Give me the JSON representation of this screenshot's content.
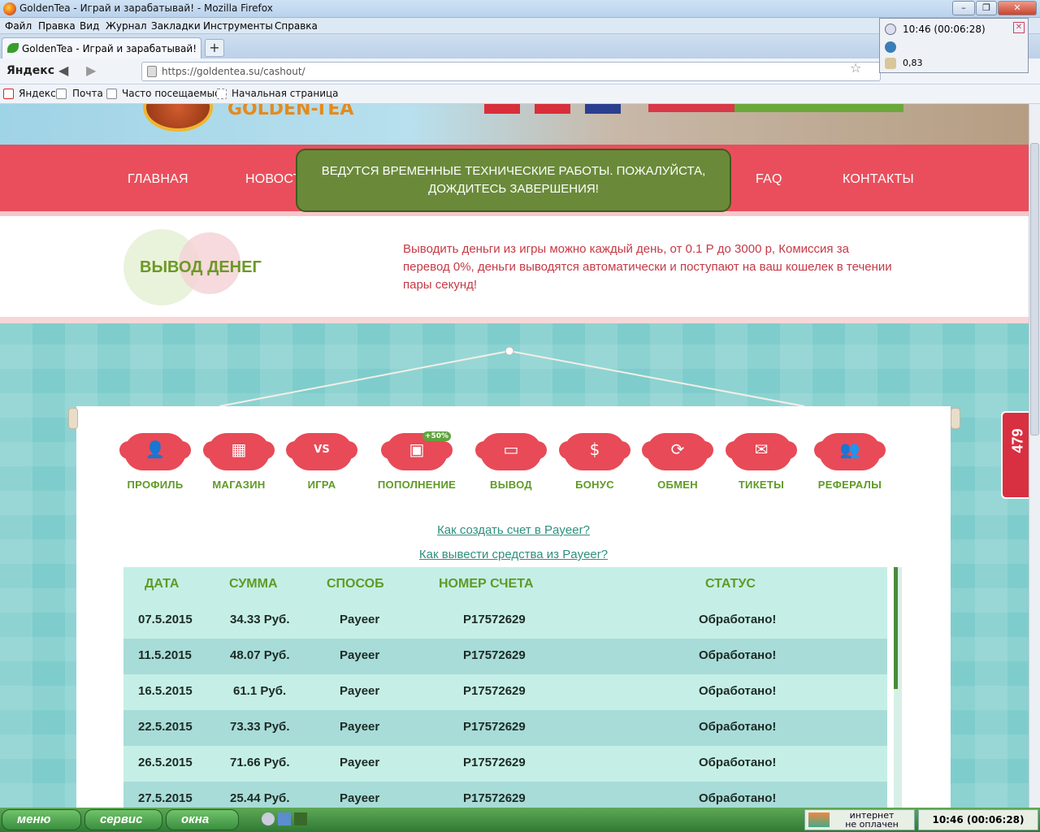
{
  "window": {
    "title": "GoldenTea - Играй и зарабатывай! - Mozilla Firefox"
  },
  "menubar": [
    "Файл",
    "Правка",
    "Вид",
    "Журнал",
    "Закладки",
    "Инструменты",
    "Справка"
  ],
  "tab": {
    "label": "GoldenTea - Играй и зарабатывай!",
    "new_tab": "+"
  },
  "nav": {
    "yandex": "Яндекс",
    "url": "https://goldentea.su/cashout/"
  },
  "bookmarks": [
    "Яндекс",
    "Почта",
    "Часто посещаемые",
    "Начальная страница"
  ],
  "clock_popup": {
    "time": "10:46 (00:06:28)",
    "value": "0,83"
  },
  "site": {
    "logo_text": "GOLDEN-TEA",
    "nav_items": [
      "ГЛАВНАЯ",
      "НОВОСТИ",
      "FAQ",
      "КОНТАКТЫ"
    ],
    "maintenance": "ВЕДУТСЯ ВРЕМЕННЫЕ ТЕХНИЧЕСКИЕ РАБОТЫ. ПОЖАЛУЙСТА, ДОЖДИТЕСЬ ЗАВЕРШЕНИЯ!",
    "section_title": "ВЫВОД ДЕНЕГ",
    "section_desc": "Выводить деньги из игры можно каждый день, от 0.1 Р до 3000 р, Комиссия за перевод 0%, деньги выводятся автоматически и поступают на ваш кошелек в течении пары секунд!",
    "menu": [
      {
        "label": "ПРОФИЛЬ",
        "icon": "user-icon"
      },
      {
        "label": "МАГАЗИН",
        "icon": "shop-icon"
      },
      {
        "label": "ИГРА",
        "icon": "vs-icon"
      },
      {
        "label": "ПОПОЛНЕНИЕ",
        "icon": "deposit-icon",
        "badge": "+50%"
      },
      {
        "label": "ВЫВОД",
        "icon": "wallet-icon"
      },
      {
        "label": "БОНУС",
        "icon": "dollar-icon"
      },
      {
        "label": "ОБМЕН",
        "icon": "exchange-icon"
      },
      {
        "label": "ТИКЕТЫ",
        "icon": "mail-icon"
      },
      {
        "label": "РЕФЕРАЛЫ",
        "icon": "referrals-icon"
      }
    ],
    "help_links": [
      "Как создать счет в Payeer?",
      "Как вывести средства из Payeer?"
    ],
    "table": {
      "headers": [
        "ДАТА",
        "СУММА",
        "СПОСОБ",
        "НОМЕР СЧЕТА",
        "СТАТУС"
      ],
      "rows": [
        [
          "07.5.2015",
          "34.33 Руб.",
          "Payeer",
          "P17572629",
          "Обработано!"
        ],
        [
          "11.5.2015",
          "48.07 Руб.",
          "Payeer",
          "P17572629",
          "Обработано!"
        ],
        [
          "16.5.2015",
          "61.1 Руб.",
          "Payeer",
          "P17572629",
          "Обработано!"
        ],
        [
          "22.5.2015",
          "73.33 Руб.",
          "Payeer",
          "P17572629",
          "Обработано!"
        ],
        [
          "26.5.2015",
          "71.66 Руб.",
          "Payeer",
          "P17572629",
          "Обработано!"
        ],
        [
          "27.5.2015",
          "25.44 Руб.",
          "Payeer",
          "P17572629",
          "Обработано!"
        ]
      ]
    },
    "side_badge": "479"
  },
  "taskbar": {
    "menu": "меню",
    "service": "сервис",
    "windows": "окна",
    "tray_line1": "интернет",
    "tray_line2": "не оплачен",
    "clock": "10:46 (00:06:28)"
  }
}
